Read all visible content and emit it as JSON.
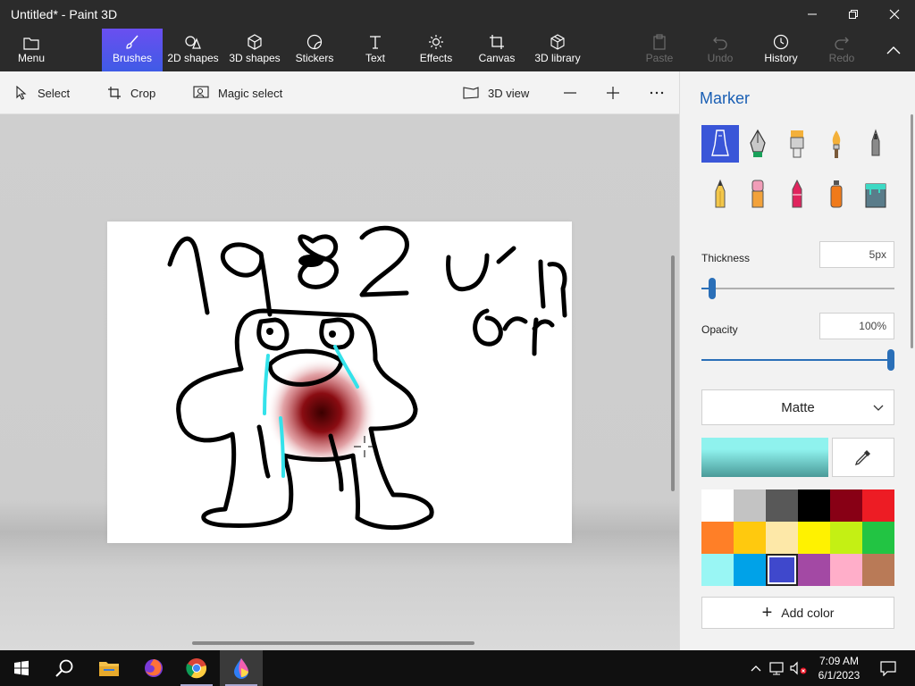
{
  "window": {
    "title": "Untitled* - Paint 3D"
  },
  "ribbon": {
    "menu": "Menu",
    "tabs": [
      "Brushes",
      "2D shapes",
      "3D shapes",
      "Stickers",
      "Text",
      "Effects",
      "Canvas",
      "3D library"
    ],
    "active_tab": "Brushes",
    "actions": {
      "paste": "Paste",
      "undo": "Undo",
      "history": "History",
      "redo": "Redo"
    }
  },
  "toolbar": {
    "select": "Select",
    "crop": "Crop",
    "magic_select": "Magic select",
    "view_3d": "3D view"
  },
  "panel": {
    "title": "Marker",
    "brushes": [
      "marker",
      "calligraphy pen",
      "oil brush",
      "watercolor",
      "pixel pen",
      "pencil",
      "eraser",
      "crayon",
      "spray can",
      "fill"
    ],
    "thickness_label": "Thickness",
    "thickness_value": "5px",
    "thickness_level": 0.05,
    "opacity_label": "Opacity",
    "opacity_value": "100%",
    "opacity_level": 1.0,
    "finish": "Matte",
    "current_color": "#8ff2ee",
    "palette": [
      "#ffffff",
      "#c3c3c3",
      "#585858",
      "#000000",
      "#880015",
      "#ed1c24",
      "#ff7f27",
      "#ffc90e",
      "#fde8a8",
      "#fff200",
      "#c4f014",
      "#22c443",
      "#99f6f4",
      "#00a2e8",
      "#3f48cc",
      "#a349a4",
      "#ffaec9",
      "#b97a57"
    ],
    "selected_swatch": 14,
    "add_color": "Add color"
  },
  "taskbar": {
    "time": "7:09 AM",
    "date": "6/1/2023"
  }
}
